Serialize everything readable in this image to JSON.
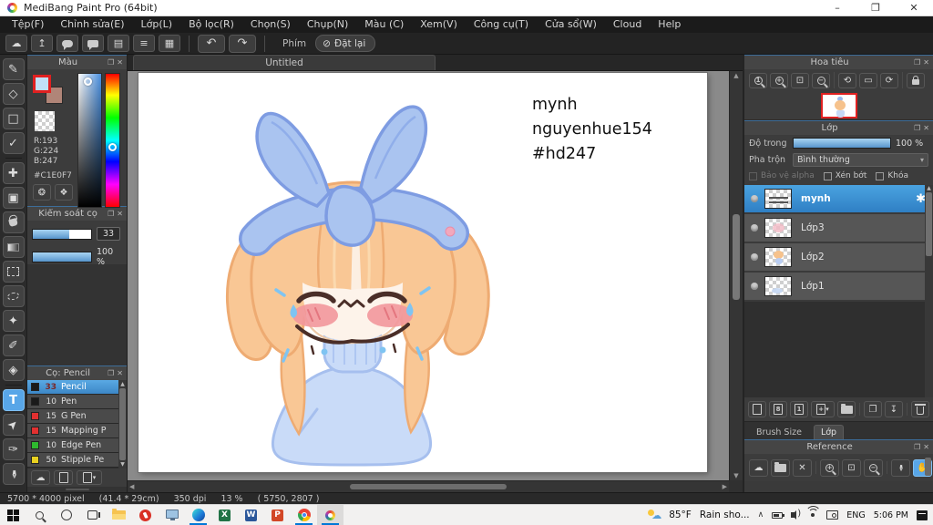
{
  "window": {
    "title": "MediBang Paint Pro (64bit)"
  },
  "icons": {
    "minimize": "–",
    "restore": "❐",
    "close": "✕",
    "cloud": "☁",
    "upload": "↥",
    "document": "▤",
    "list": "≡",
    "grid": "▦",
    "undo": "↶",
    "redo": "↷",
    "ban": "⊘",
    "popout": "❐",
    "panel_close": "✕",
    "brush": "✎",
    "eraser": "◇",
    "shape_brush": "□",
    "polyline": "✓",
    "move": "✚",
    "fill_shape": "▣",
    "magic_wand": "✦",
    "select_pen": "✐",
    "select_eraser": "◈",
    "text": "T",
    "operate": "➤",
    "blade": "✑",
    "eyedropper": "✒",
    "palette": "❂",
    "palette_set": "❖",
    "zoom_actual": "1",
    "zoom_in": "+",
    "zoom_out": "−",
    "fit": "⊡",
    "rotate_left": "⟲",
    "reset_view": "▭",
    "rotate_right": "⟳",
    "gear": "✱",
    "dropdown": "▾",
    "merge": "↧",
    "duplicate": "❐",
    "up": "▲",
    "down": "▼",
    "left": "◀",
    "right": "▶",
    "chevron_up": "∧",
    "hand": "✋",
    "layer_8bit": "8",
    "layer_1bit": "1",
    "add": "+",
    "excel": "X",
    "word": "W",
    "powerpoint": "P"
  },
  "menu_bar": {
    "items": [
      "Tệp(F)",
      "Chỉnh sửa(E)",
      "Lớp(L)",
      "Bộ lọc(R)",
      "Chọn(S)",
      "Chụp(N)",
      "Màu (C)",
      "Xem(V)",
      "Công cụ(T)",
      "Cửa sổ(W)",
      "Cloud",
      "Help"
    ]
  },
  "toolbar": {
    "key_label": "Phím",
    "reset_button": "Đặt lại"
  },
  "color_panel": {
    "title": "Màu",
    "r": "R:193",
    "g": "G:224",
    "b": "B:247",
    "hex": "#C1E0F7",
    "foreground": "#C1E0F7",
    "background": "#B08578"
  },
  "brush_control_panel": {
    "title": "Kiểm soát cọ",
    "size_value": "33",
    "opacity_value": "100 %"
  },
  "brush_panel": {
    "title": "Cọ: Pencil",
    "brushes": [
      {
        "size": "33",
        "name": "Pencil",
        "color": "#1a1a1a",
        "selected": true
      },
      {
        "size": "10",
        "name": "Pen",
        "color": "#1a1a1a",
        "selected": false
      },
      {
        "size": "15",
        "name": "G Pen",
        "color": "#e23030",
        "selected": false
      },
      {
        "size": "15",
        "name": "Mapping P",
        "color": "#e23030",
        "selected": false
      },
      {
        "size": "10",
        "name": "Edge Pen",
        "color": "#2eb82e",
        "selected": false
      },
      {
        "size": "50",
        "name": "Stipple Pe",
        "color": "#e8d020",
        "selected": false
      }
    ]
  },
  "canvas": {
    "tab_title": "Untitled",
    "text_lines": [
      "mynh",
      "nguyenhue154",
      "#hd247"
    ]
  },
  "navigator_panel": {
    "title": "Hoa tiêu"
  },
  "layers_panel": {
    "title": "Lớp",
    "opacity_label": "Độ trong",
    "opacity_value": "100 %",
    "blend_label": "Pha trộn",
    "blend_value": "Bình thường",
    "alpha_label": "Bảo vệ alpha",
    "clip_label": "Xén bớt",
    "lock_label": "Khóa",
    "layers": [
      {
        "name": "mynh",
        "selected": true
      },
      {
        "name": "Lớp3",
        "selected": false
      },
      {
        "name": "Lớp2",
        "selected": false
      },
      {
        "name": "Lớp1",
        "selected": false
      }
    ]
  },
  "dock_tabs": {
    "brush_size": "Brush Size",
    "layers": "Lớp"
  },
  "reference_panel": {
    "title": "Reference"
  },
  "status_bar": {
    "segments": [
      "5700 * 4000 pixel",
      "(41.4 * 29cm)",
      "350 dpi",
      "13 %",
      "( 5750, 2807 )"
    ]
  },
  "taskbar": {
    "temperature": "85°F",
    "weather": "Rain sho...",
    "language": "ENG",
    "time": "5:06 PM"
  },
  "colors": {
    "accent_blue": "#3f97dd",
    "selection_blue": "#4aa3e0",
    "slider_blue": "#5795cc",
    "foreground_swatch": "#C1E0F7",
    "swatch_border_red": "#e02020"
  }
}
